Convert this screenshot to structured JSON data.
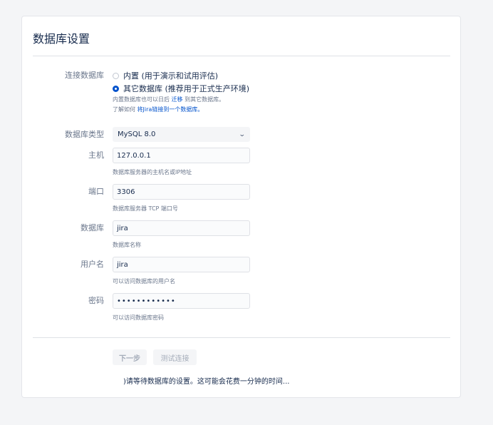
{
  "page": {
    "title": "数据库设置"
  },
  "connection": {
    "label": "连接数据库",
    "options": [
      {
        "label": "内置 (用于演示和试用评估)",
        "checked": false
      },
      {
        "label": "其它数据库 (推荐用于正式生产环境)",
        "checked": true
      }
    ],
    "note1_prefix": "内置数据库也可以日后",
    "note1_link": "迁移",
    "note1_suffix": "到其它数据库。",
    "note2_prefix": "了解如何",
    "note2_link": "将Jira链接到一个数据库。"
  },
  "db_type": {
    "label": "数据库类型",
    "value": "MySQL 8.0"
  },
  "host": {
    "label": "主机",
    "value": "127.0.0.1",
    "help": "数据库服务器的主机名或IP地址"
  },
  "port": {
    "label": "端口",
    "value": "3306",
    "help": "数据库服务器 TCP 端口号"
  },
  "database": {
    "label": "数据库",
    "value": "jira",
    "help": "数据库名称"
  },
  "username": {
    "label": "用户名",
    "value": "jira",
    "help": "可以访问数据库的用户名"
  },
  "password": {
    "label": "密码",
    "value": "••••••••••••",
    "help": "可以访问数据库密码"
  },
  "buttons": {
    "next": "下一步",
    "test": "测试连接"
  },
  "status": {
    "waiting": ")请等待数据库的设置。这可能会花费一分钟的时间..."
  },
  "icons": {
    "select_arrow": "chevron-down-icon"
  }
}
